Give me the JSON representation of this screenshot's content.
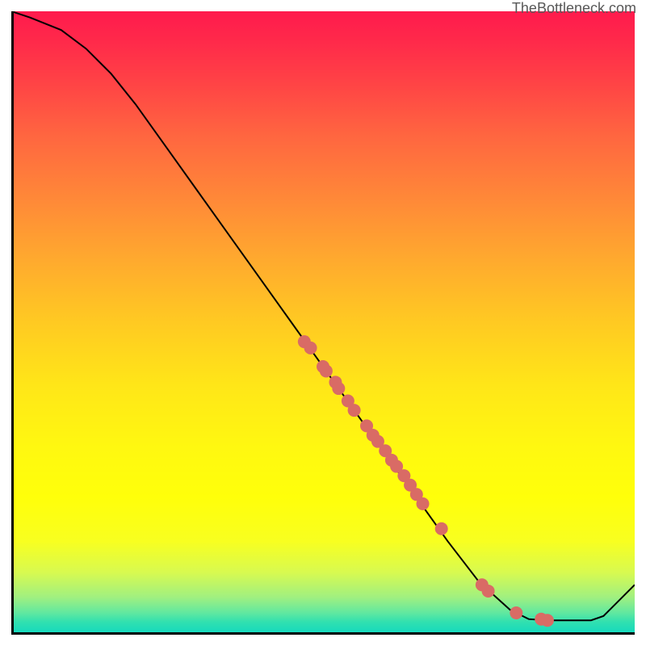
{
  "watermark": "TheBottleneck.com",
  "chart_data": {
    "type": "line",
    "title": "",
    "xlabel": "",
    "ylabel": "",
    "xlim": [
      0,
      100
    ],
    "ylim": [
      0,
      100
    ],
    "curve": [
      {
        "x": 0,
        "y": 100
      },
      {
        "x": 3,
        "y": 99
      },
      {
        "x": 8,
        "y": 97
      },
      {
        "x": 12,
        "y": 94
      },
      {
        "x": 16,
        "y": 90
      },
      {
        "x": 20,
        "y": 85
      },
      {
        "x": 25,
        "y": 78
      },
      {
        "x": 30,
        "y": 71
      },
      {
        "x": 35,
        "y": 64
      },
      {
        "x": 40,
        "y": 57
      },
      {
        "x": 45,
        "y": 50
      },
      {
        "x": 50,
        "y": 43
      },
      {
        "x": 55,
        "y": 36
      },
      {
        "x": 60,
        "y": 29
      },
      {
        "x": 65,
        "y": 22
      },
      {
        "x": 70,
        "y": 15
      },
      {
        "x": 75,
        "y": 8.5
      },
      {
        "x": 80,
        "y": 4
      },
      {
        "x": 83,
        "y": 2.5
      },
      {
        "x": 86,
        "y": 2.3
      },
      {
        "x": 90,
        "y": 2.3
      },
      {
        "x": 93,
        "y": 2.3
      },
      {
        "x": 95,
        "y": 3
      },
      {
        "x": 98,
        "y": 6
      },
      {
        "x": 100,
        "y": 8
      }
    ],
    "scatter_points": [
      {
        "x": 47,
        "y": 47
      },
      {
        "x": 48,
        "y": 46
      },
      {
        "x": 50,
        "y": 43
      },
      {
        "x": 50.5,
        "y": 42.3
      },
      {
        "x": 52,
        "y": 40.5
      },
      {
        "x": 52.5,
        "y": 39.5
      },
      {
        "x": 54,
        "y": 37.5
      },
      {
        "x": 55,
        "y": 36
      },
      {
        "x": 57,
        "y": 33.5
      },
      {
        "x": 58,
        "y": 32
      },
      {
        "x": 58.8,
        "y": 31
      },
      {
        "x": 60,
        "y": 29.5
      },
      {
        "x": 61,
        "y": 28
      },
      {
        "x": 61.8,
        "y": 27
      },
      {
        "x": 63,
        "y": 25.5
      },
      {
        "x": 64,
        "y": 24
      },
      {
        "x": 65,
        "y": 22.5
      },
      {
        "x": 66,
        "y": 21
      },
      {
        "x": 69,
        "y": 17
      },
      {
        "x": 75.5,
        "y": 8
      },
      {
        "x": 76.5,
        "y": 7
      },
      {
        "x": 81,
        "y": 3.5
      },
      {
        "x": 85,
        "y": 2.5
      },
      {
        "x": 86,
        "y": 2.3
      }
    ]
  }
}
